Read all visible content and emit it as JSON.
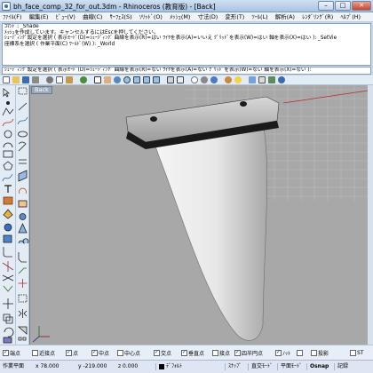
{
  "window": {
    "title": "bh_face_comp_32_for_out.3dm - Rhinoceros (教育版) - [Back]",
    "minimize": "–",
    "maximize": "□",
    "close": "✕"
  },
  "menu": [
    "ﾌｧｲﾙ(F)",
    "編集(E)",
    "ﾋﾞｭｰ(V)",
    "曲線(C)",
    "ｻｰﾌｪｽ(S)",
    "ｿﾘｯﾄﾞ(O)",
    "ﾒｯｼｭ(M)",
    "寸法(D)",
    "変形(T)",
    "ﾂｰﾙ(L)",
    "解析(A)",
    "ﾚﾝﾀﾞﾘﾝｸﾞ(R)",
    "ﾍﾙﾌﾟ(H)"
  ],
  "command_history": [
    "ｺﾏﾝﾄﾞ: _Shade",
    "ﾒｯｼｭを作成しています。キャンセルするにはEscを押してください。",
    "ｼｪｰﾃﾞｨﾝｸﾞ設定を選択 ( 表示ﾓｰﾄﾞ(D)=ｼｪｰﾃﾞｨﾝｸﾞ 曲線を表示(R)=はい ﾜｲﾔを表示(A)=いいえ ｸﾞﾘｯﾄﾞを表示(W)=はい 軸を表示(X)=はい ): _SetVie",
    "座標系を選択 ( 作業平面(C) ﾜｰﾙﾄﾞ(W) ): _World"
  ],
  "command_prompt": "ｼｪｰﾃﾞｨﾝｸﾞ設定を選択 ( 表示ﾓｰﾄﾞ(D)=ｼｪｰﾃﾞｨﾝｸﾞ 曲線を表示(R)=ない ﾜｲﾔを表示(A)=ない ｸﾞﾘｯﾄﾞを表示(W)=ない 軸を表示(X)=ない ):",
  "viewport": {
    "tab_label": "Back"
  },
  "osnap": [
    {
      "label": "端点",
      "checked": true
    },
    {
      "label": "近接点",
      "checked": false
    },
    {
      "label": "点",
      "checked": true
    },
    {
      "label": "中点",
      "checked": true
    },
    {
      "label": "中心点",
      "checked": false
    },
    {
      "label": "交点",
      "checked": true
    },
    {
      "label": "垂直点",
      "checked": true
    },
    {
      "label": "接点",
      "checked": false
    },
    {
      "label": "四半円点",
      "checked": true
    },
    {
      "label": "ﾉｯﾄ",
      "checked": true
    },
    {
      "label": "",
      "checked": false
    },
    {
      "label": "投影",
      "checked": false
    },
    {
      "label": "ST",
      "checked": false
    }
  ],
  "status": {
    "cplane": "作業平面",
    "x": "x 78.000",
    "y": "y -219.000",
    "z": "z 0.000",
    "layer": "ﾃﾞﾌｫﾙﾄ",
    "snap": "ｽﾅｯﾌﾟ",
    "ortho": "直交ﾓｰﾄﾞ",
    "planar": "平面ﾓｰﾄﾞ",
    "osnap": "Osnap",
    "record": "記録"
  }
}
